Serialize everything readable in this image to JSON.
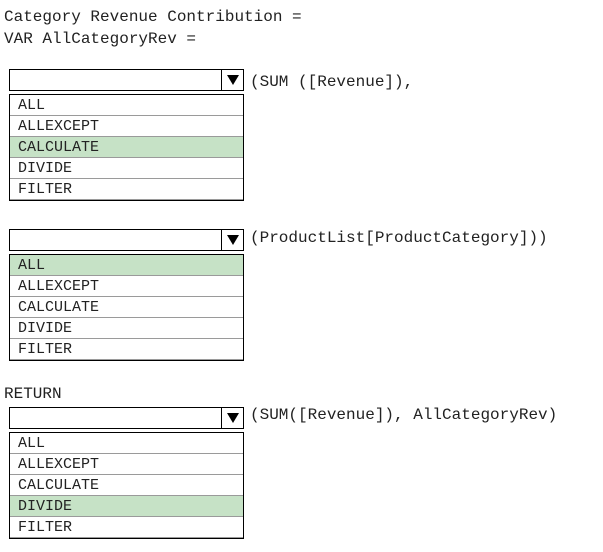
{
  "code": {
    "line1": "Category Revenue Contribution =",
    "line2": "VAR AllCategoryRev =",
    "return_keyword": "RETURN"
  },
  "dropdowns": [
    {
      "selected_value": "",
      "trailing_text": "(SUM ([Revenue]),",
      "options": [
        "ALL",
        "ALLEXCEPT",
        "CALCULATE",
        "DIVIDE",
        "FILTER"
      ],
      "highlighted_option": "CALCULATE"
    },
    {
      "selected_value": "",
      "trailing_text": "(ProductList[ProductCategory]))",
      "options": [
        "ALL",
        "ALLEXCEPT",
        "CALCULATE",
        "DIVIDE",
        "FILTER"
      ],
      "highlighted_option": "ALL"
    },
    {
      "selected_value": "",
      "trailing_text": "(SUM([Revenue]), AllCategoryRev)",
      "options": [
        "ALL",
        "ALLEXCEPT",
        "CALCULATE",
        "DIVIDE",
        "FILTER"
      ],
      "highlighted_option": "DIVIDE"
    }
  ],
  "colors": {
    "highlight": "#c6e2c6",
    "border": "#000000",
    "divider": "#9a9a9a"
  },
  "icons": {
    "dropdown_arrow": "triangle-down-icon"
  }
}
